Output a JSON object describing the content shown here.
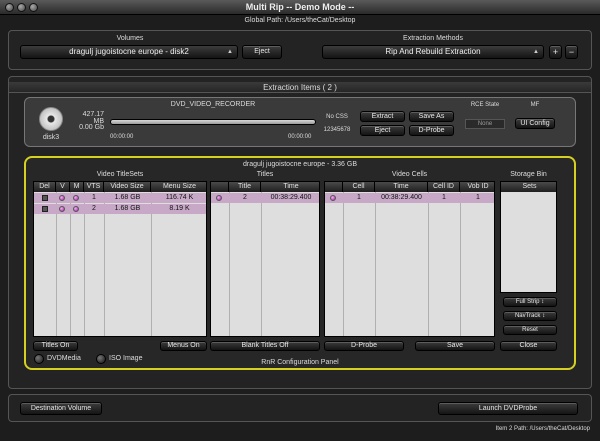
{
  "window": {
    "title": "Multi Rip -- Demo Mode --",
    "global_path": "Global Path: /Users/theCat/Desktop"
  },
  "volumes": {
    "label": "Volumes",
    "selected": "dragulj jugoistocne europe - disk2",
    "eject_label": "Eject"
  },
  "extraction": {
    "label": "Extraction Methods",
    "selected": "Rip And Rebuild Extraction",
    "plus": "+",
    "minus": "−"
  },
  "items_tab": "Extraction Items ( 2 )",
  "disk": {
    "name": "disk3",
    "size": "427.17 MB",
    "free": "0.00 Gb",
    "title": "DVD_VIDEO_RECORDER",
    "time_start": "00:00:00",
    "time_end": "00:00:00",
    "progress": 0.0,
    "css": "No CSS",
    "serial": "12345678",
    "extract": "Extract",
    "save_as": "Save As",
    "eject": "Eject",
    "dprobe": "D-Probe",
    "rce_label": "RCE State",
    "rce_value": "None",
    "mf_label": "MF",
    "ui_config": "UI Config"
  },
  "config": {
    "header": "dragulj jugoistocne europe - 3.36 GB",
    "video_titlesets": "Video TitleSets",
    "titles": "Titles",
    "video_cells": "Video Cells",
    "storage_bin": "Storage Bin",
    "vts_columns": [
      "Del",
      "V",
      "M",
      "VTS",
      "Video Size",
      "Menu Size"
    ],
    "vts_rows": [
      {
        "vts": "1",
        "video": "1.68 GB",
        "menu": "116.74 K"
      },
      {
        "vts": "2",
        "video": "1.68 GB",
        "menu": "8.19 K"
      }
    ],
    "title_columns": [
      "Title",
      "Time"
    ],
    "title_rows": [
      {
        "title": "2",
        "time": "00:38:29.400"
      }
    ],
    "cell_columns": [
      "Cell",
      "Time",
      "Cell ID",
      "Vob ID"
    ],
    "cell_rows": [
      {
        "cell": "1",
        "time": "00:38:29.400",
        "cell_id": "1",
        "vob_id": "1"
      }
    ],
    "sets_column": "Sets",
    "full_strip": "Full Strip",
    "navtrack": "NavTrack",
    "reset": "Reset",
    "close": "Close",
    "titles_on": "Titles On",
    "menus_on": "Menus On",
    "blank_titles_off": "Blank Titles Off",
    "dprobe": "D-Probe",
    "save": "Save",
    "dvdmedia": "DVDMedia",
    "iso_image": "ISO Image",
    "footer": "RnR Configuration Panel"
  },
  "bottom": {
    "destination": "Destination Volume",
    "launch": "Launch DVDProbe",
    "item_path": "Item 2 Path: /Users/theCat/Desktop"
  }
}
